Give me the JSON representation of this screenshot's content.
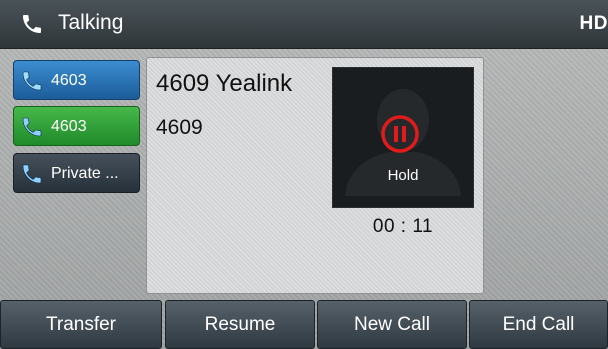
{
  "status_bar": {
    "title": "Talking",
    "badge": "HD",
    "icon": "handset-icon"
  },
  "line_keys": [
    {
      "label": "4603",
      "color": "#2a74b8",
      "icon": "handset-icon"
    },
    {
      "label": "4603",
      "color": "#2ea336",
      "icon": "handset-icon"
    },
    {
      "label": "Private ...",
      "color": "#333d46",
      "icon": "handset-icon"
    }
  ],
  "call": {
    "name": "4609 Yealink",
    "number": "4609",
    "state": "Hold",
    "timer": "00 : 11",
    "hold_color": "#e01b1b"
  },
  "softkeys": [
    "Transfer",
    "Resume",
    "New Call",
    "End Call"
  ]
}
